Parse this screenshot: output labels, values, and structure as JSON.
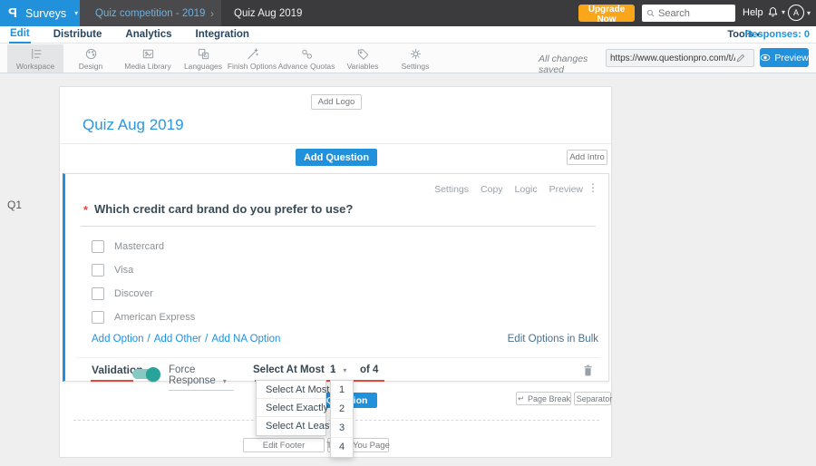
{
  "colors": {
    "brand_blue": "#2191dc",
    "upgrade_orange": "#f9a61a",
    "toggle_teal": "#27a399",
    "annotation_red": "#df4a3f",
    "topbar_dark": "#3b3b3d"
  },
  "topbar": {
    "logo": "P",
    "surveys_label": "Surveys",
    "breadcrumb": {
      "parent": "Quiz competition - 2019",
      "current": "Quiz Aug 2019"
    },
    "upgrade_label": "Upgrade Now",
    "search_placeholder": "Search",
    "help_label": "Help",
    "avatar_initial": "A"
  },
  "nav": {
    "tabs": [
      "Edit",
      "Distribute",
      "Analytics",
      "Integration"
    ],
    "tools_label": "Tools",
    "responses_label": "Responses: 0"
  },
  "toolbar": {
    "items": [
      {
        "label": "Workspace",
        "icon": "workspace-icon"
      },
      {
        "label": "Design",
        "icon": "design-icon"
      },
      {
        "label": "Media Library",
        "icon": "media-library-icon"
      },
      {
        "label": "Languages",
        "icon": "languages-icon"
      },
      {
        "label": "Finish Options",
        "icon": "finish-options-icon"
      },
      {
        "label": "Advance Quotas",
        "icon": "advance-quotas-icon"
      },
      {
        "label": "Variables",
        "icon": "variables-icon"
      },
      {
        "label": "Settings",
        "icon": "settings-icon"
      }
    ],
    "saved_text": "All changes saved",
    "url_value": "https://www.questionpro.com/t/APNrFZ",
    "preview_label": "Preview"
  },
  "canvas": {
    "q_label": "Q1",
    "add_logo": "Add Logo",
    "survey_title": "Quiz Aug 2019",
    "add_question": "Add Question",
    "add_intro": "Add Intro"
  },
  "question": {
    "actions": [
      "Settings",
      "Copy",
      "Logic",
      "Preview"
    ],
    "required_marker": "*",
    "text": "Which credit card brand do you prefer to use?",
    "options": [
      "Mastercard",
      "Visa",
      "Discover",
      "American Express"
    ],
    "option_links": [
      "Add Option",
      "Add Other",
      "Add NA Option"
    ],
    "link_separator": "/",
    "edit_bulk": "Edit Options in Bulk",
    "validation": {
      "label": "Validation",
      "force_response": "Force Response",
      "rule_selected": "Select At Most",
      "count_selected": "1",
      "of_label": "of 4"
    }
  },
  "dropdowns": {
    "rule_options": [
      "Select At Most",
      "Select Exactly",
      "Select At Least"
    ],
    "count_options": [
      "1",
      "2",
      "3",
      "4"
    ]
  },
  "footer": {
    "add_question": "Add Question",
    "page_break": "Page Break",
    "separator": "Separator",
    "edit_footer": "Edit Footer",
    "thank_you": "Thank You Page"
  }
}
